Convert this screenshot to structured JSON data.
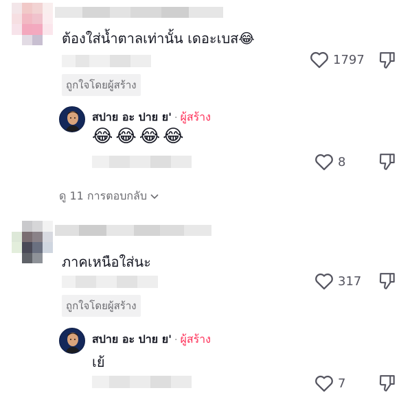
{
  "colors": {
    "creator": "#fe2c55",
    "muted_text": "#6b6b70",
    "text": "#161823",
    "chip_bg": "#f1f1f2"
  },
  "comments": [
    {
      "text": "ต้องใส่น้ำตาลเท่านั้น เดอะเบส😂",
      "likes": "1797",
      "liked_by_creator": "ถูกใจโดยผู้สร้าง",
      "reply": {
        "author": "สปาย อะ ปาย ย'",
        "dot": "·",
        "creator_label": "ผู้สร้าง",
        "text": "😂😂😂😂",
        "likes": "8"
      },
      "view_replies": "ดู 11 การตอบกลับ"
    },
    {
      "text": "ภาคเหนือใส่นะ",
      "likes": "317",
      "liked_by_creator": "ถูกใจโดยผู้สร้าง",
      "reply": {
        "author": "สปาย อะ ปาย ย'",
        "dot": "·",
        "creator_label": "ผู้สร้าง",
        "text": "เย้",
        "likes": "7"
      }
    }
  ],
  "icons": {
    "like": "heart-outline-icon",
    "dislike": "thumbs-down-icon",
    "chevron": "chevron-down-icon"
  }
}
